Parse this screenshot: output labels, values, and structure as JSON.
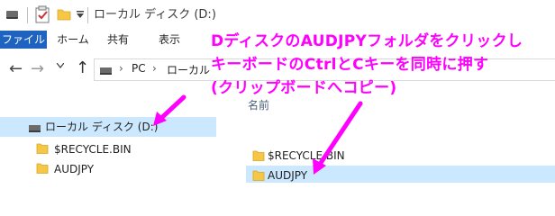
{
  "titlebar": {
    "title": "ローカル ディスク (D:)"
  },
  "ribbon": {
    "tabs": [
      {
        "label": "ファイル"
      },
      {
        "label": "ホーム"
      },
      {
        "label": "共有"
      },
      {
        "label": "表示"
      }
    ]
  },
  "address": {
    "crumbs": [
      "PC",
      "ローカル"
    ]
  },
  "navpane": {
    "drive_label": "ローカル ディスク (D:)",
    "children": [
      {
        "label": "$RECYCLE.BIN"
      },
      {
        "label": "AUDJPY"
      }
    ]
  },
  "content": {
    "column_name": "名前",
    "files": [
      {
        "label": "$RECYCLE.BIN"
      },
      {
        "label": "AUDJPY"
      }
    ]
  },
  "annotation": {
    "lines": [
      "DディスクのAUDJPYフォルダをクリックし",
      "キーボードのCtrlとCキーを同時に押す",
      "(クリップボードへコピー)"
    ]
  },
  "colors": {
    "accent": "#1f63c1",
    "selection": "#cce8ff",
    "annotation": "#ff00ff",
    "folder": "#f6c744"
  },
  "icons": [
    "drive-icon",
    "checkbox-icon",
    "folder-icon",
    "back-arrow-icon",
    "forward-arrow-icon",
    "up-arrow-icon",
    "chevron-right-icon"
  ]
}
